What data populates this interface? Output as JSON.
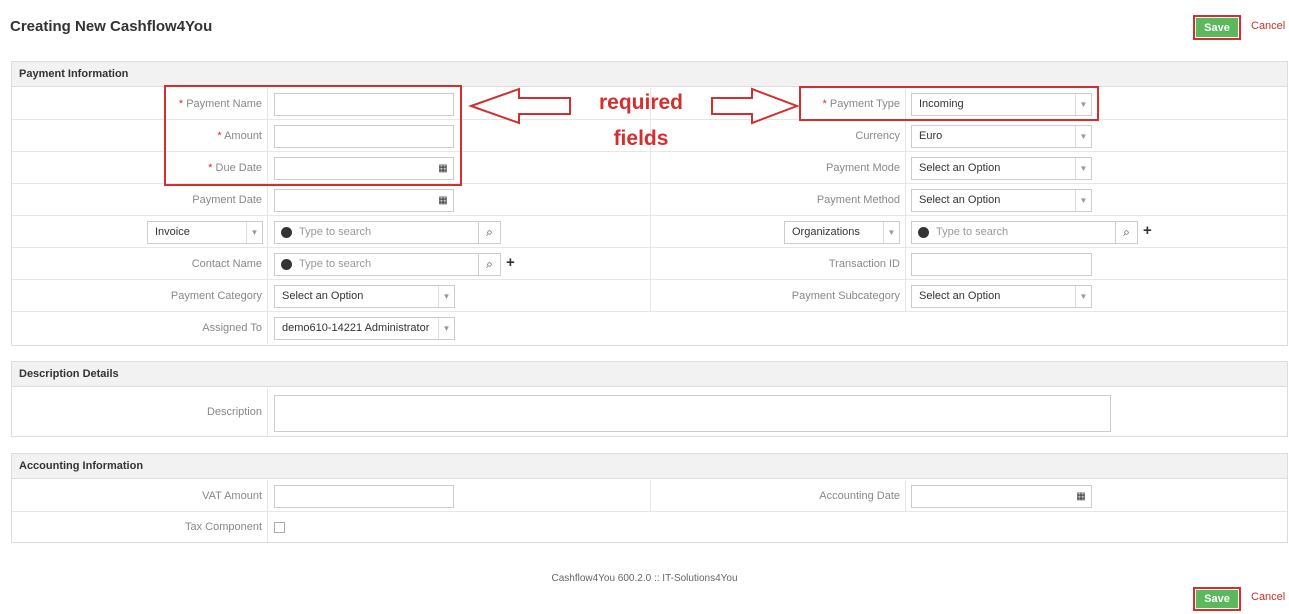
{
  "page": {
    "title": "Creating New Cashflow4You"
  },
  "actions": {
    "save": "Save",
    "cancel": "Cancel"
  },
  "payment_info": {
    "header": "Payment Information",
    "payment_name_label": "Payment Name",
    "payment_type_label": "Payment Type",
    "payment_type_value": "Incoming",
    "amount_label": "Amount",
    "currency_label": "Currency",
    "currency_value": "Euro",
    "due_date_label": "Due Date",
    "payment_mode_label": "Payment Mode",
    "payment_mode_value": "Select an Option",
    "payment_date_label": "Payment Date",
    "payment_method_label": "Payment Method",
    "payment_method_value": "Select an Option",
    "related_left_select": "Invoice",
    "related_left_placeholder": "Type to search",
    "related_right_select": "Organizations",
    "related_right_placeholder": "Type to search",
    "contact_name_label": "Contact Name",
    "contact_name_placeholder": "Type to search",
    "transaction_id_label": "Transaction ID",
    "payment_category_label": "Payment Category",
    "payment_category_value": "Select an Option",
    "payment_subcategory_label": "Payment Subcategory",
    "payment_subcategory_value": "Select an Option",
    "assigned_to_label": "Assigned To",
    "assigned_to_value": "demo610-14221 Administrator",
    "required_mark": "*"
  },
  "description": {
    "header": "Description Details",
    "description_label": "Description"
  },
  "accounting": {
    "header": "Accounting Information",
    "vat_amount_label": "VAT Amount",
    "accounting_date_label": "Accounting Date",
    "tax_component_label": "Tax Component"
  },
  "annotation": {
    "line1": "required",
    "line2": "fields"
  },
  "footer": {
    "text": "Cashflow4You 600.2.0 :: IT-Solutions4You"
  },
  "colors": {
    "accent_save": "#5cb85c",
    "annotation_red": "#d32f2f",
    "header_bg": "#f2f2f2"
  },
  "icons": [
    "calendar-icon",
    "search-icon",
    "plus-icon",
    "clear-circle-icon",
    "caret-down-icon"
  ]
}
